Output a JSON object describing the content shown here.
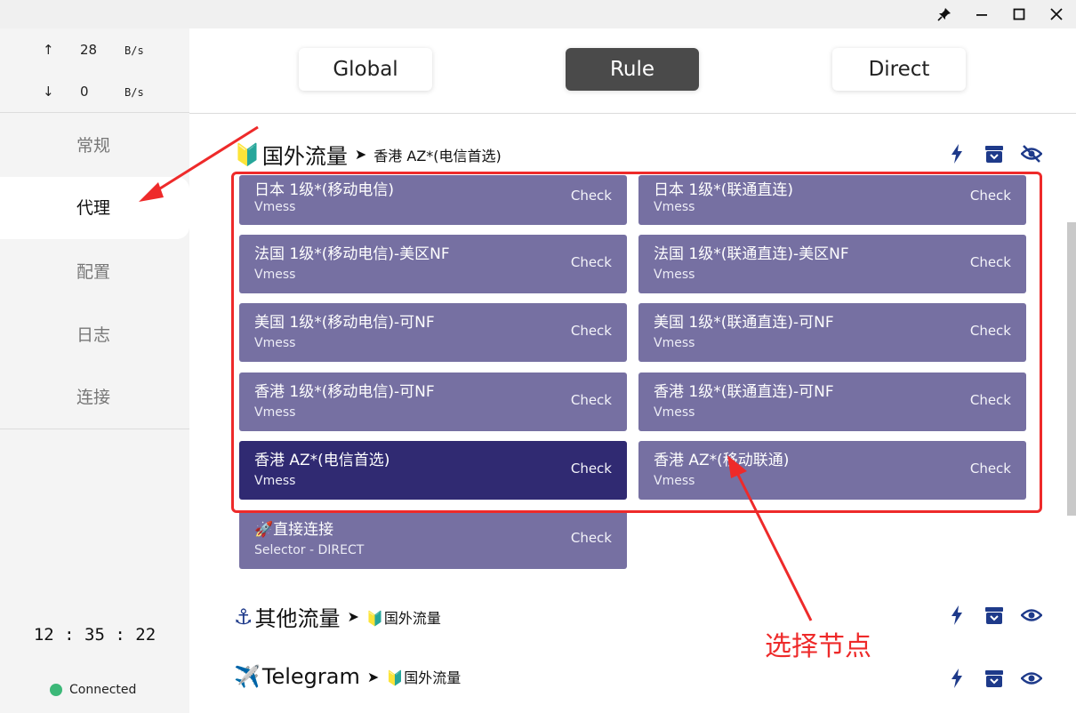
{
  "window_controls": {
    "pin_icon": "pin-icon",
    "minimize_icon": "minimize-icon",
    "maximize_icon": "maximize-icon",
    "close_icon": "close-icon"
  },
  "traffic": {
    "up": {
      "arrow": "↑",
      "value": "28",
      "unit": "B/s"
    },
    "down": {
      "arrow": "↓",
      "value": "0",
      "unit": "B/s"
    }
  },
  "nav": {
    "items": [
      {
        "label": "常规",
        "active": false
      },
      {
        "label": "代理",
        "active": true
      },
      {
        "label": "配置",
        "active": false
      },
      {
        "label": "日志",
        "active": false
      },
      {
        "label": "连接",
        "active": false
      }
    ]
  },
  "clock": "12 : 35 : 22",
  "status": {
    "label": "Connected",
    "color": "#3cb878"
  },
  "modes": {
    "global": "Global",
    "rule": "Rule",
    "direct": "Direct",
    "active": "Rule"
  },
  "groups": [
    {
      "emoji": "🔰",
      "name": "国外流量",
      "separator": "➤",
      "now": "香港 AZ*(电信首选)",
      "visibility_icon": "eye-slash-icon",
      "nodes": [
        {
          "name": "日本 1级*(移动电信)",
          "type": "Vmess",
          "check": "Check",
          "selected": false
        },
        {
          "name": "日本 1级*(联通直连)",
          "type": "Vmess",
          "check": "Check",
          "selected": false
        },
        {
          "name": "法国 1级*(移动电信)-美区NF",
          "type": "Vmess",
          "check": "Check",
          "selected": false
        },
        {
          "name": "法国 1级*(联通直连)-美区NF",
          "type": "Vmess",
          "check": "Check",
          "selected": false
        },
        {
          "name": "美国 1级*(移动电信)-可NF",
          "type": "Vmess",
          "check": "Check",
          "selected": false
        },
        {
          "name": "美国 1级*(联通直连)-可NF",
          "type": "Vmess",
          "check": "Check",
          "selected": false
        },
        {
          "name": "香港 1级*(移动电信)-可NF",
          "type": "Vmess",
          "check": "Check",
          "selected": false
        },
        {
          "name": "香港 1级*(联通直连)-可NF",
          "type": "Vmess",
          "check": "Check",
          "selected": false
        },
        {
          "name": "香港 AZ*(电信首选)",
          "type": "Vmess",
          "check": "Check",
          "selected": true
        },
        {
          "name": "香港 AZ*(移动联通)",
          "type": "Vmess",
          "check": "Check",
          "selected": false
        },
        {
          "name": "🚀直接连接",
          "type": "Selector - DIRECT",
          "check": "Check",
          "selected": false
        }
      ]
    },
    {
      "emoji": "⚓",
      "name": "其他流量",
      "separator": "➤",
      "now": "🔰国外流量",
      "visibility_icon": "eye-icon"
    },
    {
      "emoji": "✈️",
      "name": "Telegram",
      "separator": "➤",
      "now": "🔰国外流量",
      "visibility_icon": "eye-icon"
    }
  ],
  "annotation": {
    "label": "选择节点",
    "color": "#ee2a2a"
  },
  "colors": {
    "node": "#7670a2",
    "node_selected": "#302a72",
    "icon": "#1e3a8a",
    "accent_red": "#ee2a2a"
  }
}
